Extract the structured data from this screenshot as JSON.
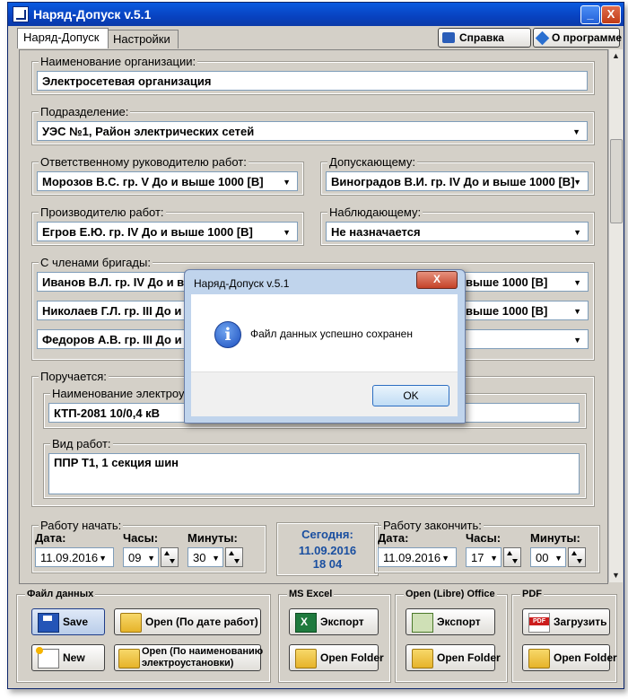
{
  "window": {
    "title": "Наряд-Допуск v.5.1",
    "min_glyph": "_",
    "close_glyph": "X"
  },
  "tabs": [
    {
      "label": "Наряд-Допуск",
      "active": true
    },
    {
      "label": "Настройки",
      "active": false
    }
  ],
  "top_buttons": {
    "help": "Справка",
    "about": "О программе"
  },
  "org": {
    "label": "Наименование организации:",
    "value": "Электросетевая организация"
  },
  "division": {
    "label": "Подразделение:",
    "value": "УЭС №1, Район электрических сетей"
  },
  "responsible": {
    "label": "Ответственному руководителю работ:",
    "value": "Морозов В.С. гр. V До и выше 1000 [В]"
  },
  "admitter": {
    "label": "Допускающему:",
    "value": "Виноградов В.И. гр. IV До и выше 1000 [В]"
  },
  "producer": {
    "label": "Производителю работ:",
    "value": "Егров Е.Ю. гр. IV До и выше 1000 [В]"
  },
  "observer": {
    "label": "Наблюдающему:",
    "value": "Не назначается"
  },
  "team": {
    "label": "С членами бригады:",
    "left": [
      "Иванов В.Л. гр. IV До и в",
      "Николаев Г.Л. гр. III До и в",
      "Федоров А.В. гр. III До и в"
    ],
    "right": [
      "выше 1000 [В]",
      "выше 1000 [В]",
      ""
    ]
  },
  "assigned": {
    "label": "Поручается:",
    "installation_label": "Наименование электроус",
    "installation_value": "КТП-2081 10/0,4 кВ",
    "work_label": "Вид работ:",
    "work_value": "ППР Т1, 1 секция шин"
  },
  "start": {
    "label": "Работу начать:",
    "date_label": "Дата:",
    "date": "11.09.2016",
    "hours_label": "Часы:",
    "hours": "09",
    "minutes_label": "Минуты:",
    "minutes": "30"
  },
  "today": {
    "label": "Сегодня:",
    "date": "11.09.2016",
    "time": "18 04"
  },
  "end": {
    "label": "Работу закончить:",
    "date_label": "Дата:",
    "date": "11.09.2016",
    "hours_label": "Часы:",
    "hours": "17",
    "minutes_label": "Минуты:",
    "minutes": "00"
  },
  "bottom": {
    "data_file": {
      "title": "Файл данных",
      "save": "Save",
      "new": "New",
      "open_date": "Open (По дате работ)",
      "open_name_1": "Open (По наименованию",
      "open_name_2": "электроустановки)"
    },
    "excel": {
      "title": "MS Excel",
      "export": "Экспорт",
      "open_folder": "Open Folder"
    },
    "libre": {
      "title": "Open (Libre) Office",
      "export": "Экспорт",
      "open_folder": "Open Folder"
    },
    "pdf": {
      "title": "PDF",
      "load": "Загрузить",
      "open_folder": "Open Folder"
    }
  },
  "dialog": {
    "title": "Наряд-Допуск v.5.1",
    "close_glyph": "X",
    "icon_glyph": "i",
    "message": "Файл данных успешно сохранен",
    "ok": "OK"
  },
  "colors": {
    "title_bar": "#0a4fd0",
    "accent_text": "#1a4fa0",
    "face": "#d4d0c8",
    "dialog_frame": "#c0d4ec"
  }
}
